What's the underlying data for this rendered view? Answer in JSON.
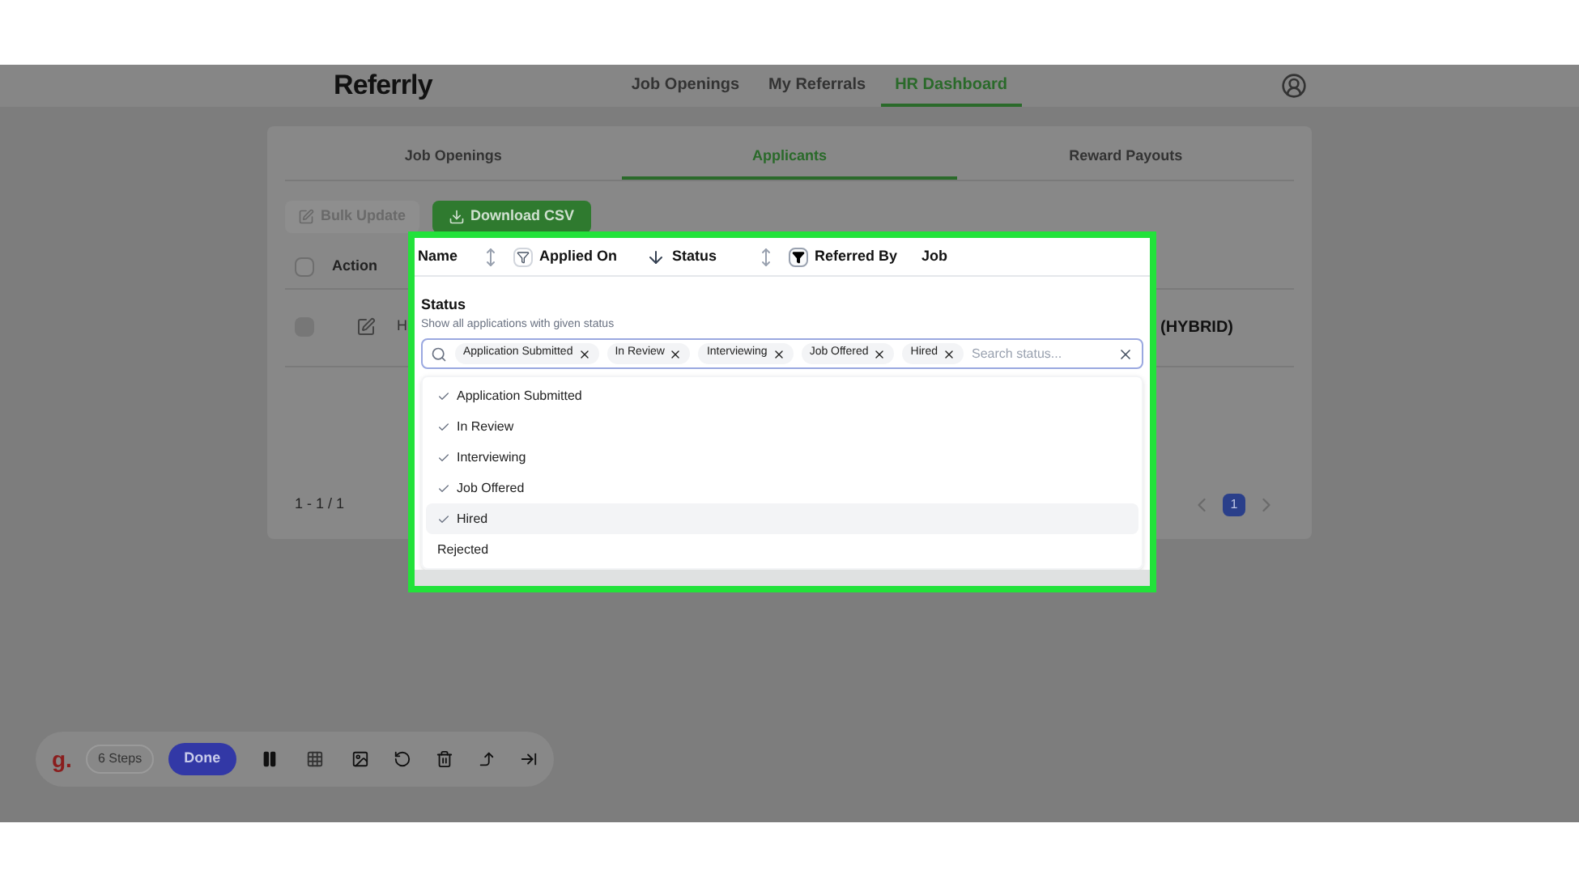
{
  "header": {
    "logo": "Referrly",
    "nav": [
      {
        "label": "Job Openings",
        "selected": false
      },
      {
        "label": "My Referrals",
        "selected": false
      },
      {
        "label": "HR Dashboard",
        "selected": true
      }
    ]
  },
  "tabs": [
    {
      "label": "Job Openings",
      "selected": false
    },
    {
      "label": "Applicants",
      "selected": true
    },
    {
      "label": "Reward Payouts",
      "selected": false
    }
  ],
  "actions": {
    "bulk_update": {
      "label": "Bulk Update",
      "disabled": true
    },
    "download": {
      "label": "Download CSV",
      "disabled": false
    }
  },
  "table": {
    "action_column": "Action",
    "header_checked": false,
    "rows": [
      {
        "checked": false,
        "name": "H",
        "job": "(HYBRID)"
      }
    ]
  },
  "pagination": {
    "range": "1 - 1 / 1",
    "pages": [
      {
        "label": "1",
        "selected": true
      }
    ]
  },
  "popup": {
    "columns": [
      {
        "label": "Name",
        "sortable": true,
        "sorted": false,
        "filter": false
      },
      {
        "label": "Applied On",
        "sortable": true,
        "sorted": true
      },
      {
        "label": "Status",
        "sortable": true,
        "sorted": false,
        "filter": true
      },
      {
        "label": "Referred By",
        "sortable": false
      },
      {
        "label": "Job",
        "sortable": false
      }
    ],
    "filter": {
      "title": "Status",
      "subtitle": "Show all applications with given status",
      "chips": [
        "Application Submitted",
        "In Review",
        "Interviewing",
        "Job Offered",
        "Hired"
      ],
      "placeholder": "Search status...",
      "options": [
        {
          "label": "Application Submitted",
          "checked": true,
          "highlighted": false
        },
        {
          "label": "In Review",
          "checked": true,
          "highlighted": false
        },
        {
          "label": "Interviewing",
          "checked": true,
          "highlighted": false
        },
        {
          "label": "Job Offered",
          "checked": true,
          "highlighted": false
        },
        {
          "label": "Hired",
          "checked": true,
          "highlighted": true
        },
        {
          "label": "Rejected",
          "checked": false,
          "highlighted": false
        }
      ]
    }
  },
  "toolbar": {
    "logo": "g.",
    "steps": "6 Steps",
    "done": "Done"
  }
}
